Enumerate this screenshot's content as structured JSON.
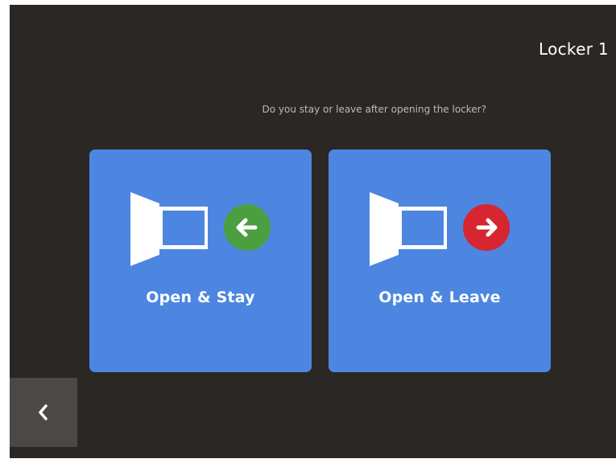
{
  "header": {
    "title": "Locker 1"
  },
  "prompt": {
    "text": "Do you stay or leave after opening the locker?"
  },
  "options": [
    {
      "label": "Open & Stay",
      "icon": "locker-open-icon",
      "badge_icon": "arrow-left-icon",
      "badge_color": "#4c9f3f"
    },
    {
      "label": "Open & Leave",
      "icon": "locker-open-icon",
      "badge_icon": "arrow-right-icon",
      "badge_color": "#d7262f"
    }
  ],
  "navigation": {
    "back_icon": "chevron-left-icon"
  },
  "colors": {
    "background": "#2b2725",
    "card": "#4d86e0",
    "back_button": "#4c4846"
  }
}
